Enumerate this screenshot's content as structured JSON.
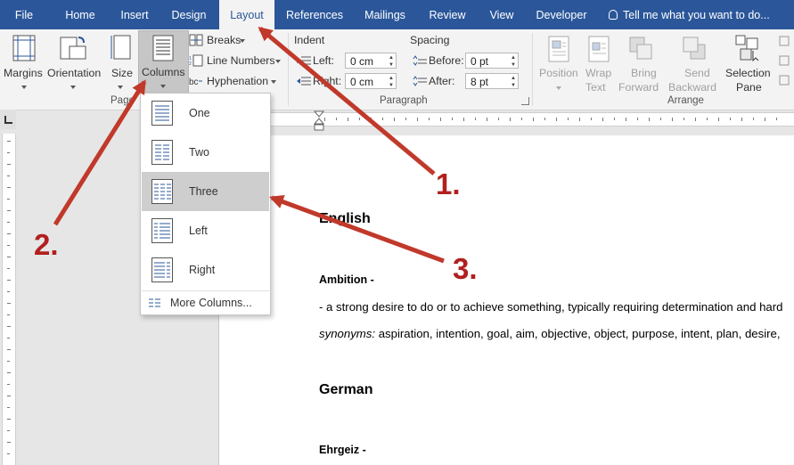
{
  "tabs": [
    "File",
    "Home",
    "Insert",
    "Design",
    "Layout",
    "References",
    "Mailings",
    "Review",
    "View",
    "Developer"
  ],
  "active_tab": "Layout",
  "tell_me": "Tell me what you want to do...",
  "page_setup": {
    "margins": "Margins",
    "orientation": "Orientation",
    "size": "Size",
    "columns": "Columns",
    "breaks": "Breaks",
    "line_numbers": "Line Numbers",
    "hyphenation": "Hyphenation",
    "group_label": "Page"
  },
  "paragraph": {
    "indent_title": "Indent",
    "spacing_title": "Spacing",
    "left_label": "Left:",
    "right_label": "Right:",
    "before_label": "Before:",
    "after_label": "After:",
    "left_value": "0 cm",
    "right_value": "0 cm",
    "before_value": "0 pt",
    "after_value": "8 pt",
    "group_label": "Paragraph"
  },
  "arrange": {
    "position": [
      "Position"
    ],
    "wrap": [
      "Wrap",
      "Text"
    ],
    "bring": [
      "Bring",
      "Forward"
    ],
    "send": [
      "Send",
      "Backward"
    ],
    "selection": [
      "Selection",
      "Pane"
    ],
    "group_label": "Arrange"
  },
  "columns_menu": {
    "items": [
      "One",
      "Two",
      "Three",
      "Left",
      "Right"
    ],
    "highlighted": "Three",
    "more": "More Columns..."
  },
  "document": {
    "h1": "English",
    "term1": "Ambition -",
    "def1": "- a strong desire to do or to achieve something, typically requiring determination and hard",
    "syn_label": "synonyms:",
    "syn_text": " aspiration, intention, goal, aim, objective, object, purpose, intent, plan, desire,",
    "h2": "German",
    "term2": "Ehrgeiz -"
  },
  "annotations": [
    "1.",
    "2.",
    "3."
  ],
  "colors": {
    "ribbon_blue": "#2b579a",
    "arrow_red": "#c0392b",
    "highlight_gray": "#cecece"
  }
}
